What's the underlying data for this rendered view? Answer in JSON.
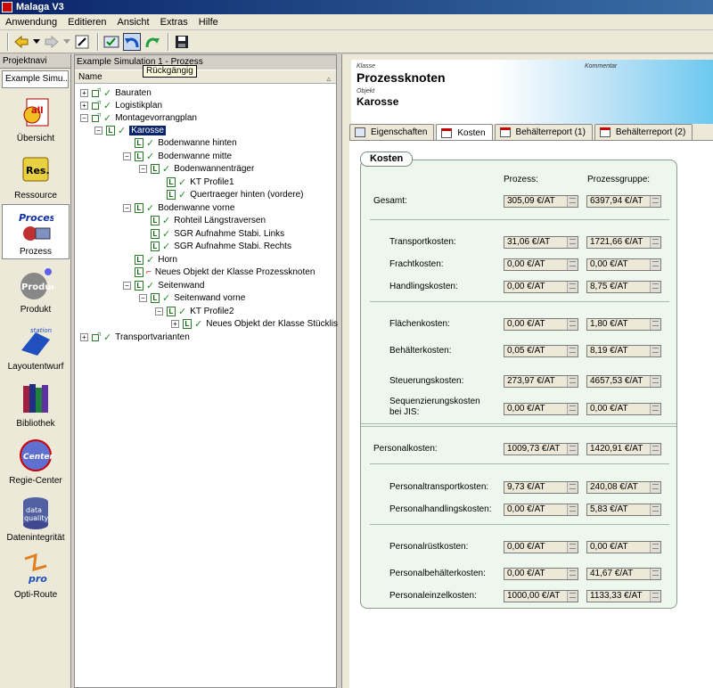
{
  "app": {
    "title": "Malaga V3"
  },
  "menu": [
    "Anwendung",
    "Editieren",
    "Ansicht",
    "Extras",
    "Hilfe"
  ],
  "tooltip": "Rückgängig",
  "left": {
    "header": "Projektnavi",
    "tab": "Example Simu...",
    "items": [
      {
        "label": "Übersicht",
        "icon": "overview-icon"
      },
      {
        "label": "Ressource",
        "icon": "resource-icon"
      },
      {
        "label": "Prozess",
        "icon": "process-icon"
      },
      {
        "label": "Produkt",
        "icon": "product-icon"
      },
      {
        "label": "Layoutentwurf",
        "icon": "layout-icon"
      },
      {
        "label": "Bibliothek",
        "icon": "library-icon"
      },
      {
        "label": "Regie-Center",
        "icon": "regie-icon"
      },
      {
        "label": "Datenintegrität",
        "icon": "data-quality-icon"
      },
      {
        "label": "Opti-Route",
        "icon": "opti-route-icon"
      }
    ]
  },
  "tree": {
    "title": "Example Simulation 1 - Prozess",
    "column": "Name",
    "rows": [
      {
        "label": "Bauraten",
        "exp": "+",
        "ico": "plus",
        "check": true
      },
      {
        "label": "Logistikplan",
        "exp": "+",
        "ico": "plus",
        "check": true
      },
      {
        "label": "Montagevorrangplan",
        "exp": "−",
        "ico": "plus",
        "check": true
      },
      {
        "label": "Karosse",
        "exp": "−",
        "ico": "box",
        "check": true,
        "selected": true
      },
      {
        "label": "Bodenwanne hinten",
        "exp": "",
        "ico": "box",
        "check": true
      },
      {
        "label": "Bodenwanne mitte",
        "exp": "−",
        "ico": "box",
        "check": true
      },
      {
        "label": "Bodenwannenträger",
        "exp": "−",
        "ico": "box",
        "check": true
      },
      {
        "label": "KT Profile1",
        "exp": "",
        "ico": "box",
        "check": true
      },
      {
        "label": "Quertraeger hinten (vordere)",
        "exp": "",
        "ico": "box",
        "check": true
      },
      {
        "label": "Bodenwanne vorne",
        "exp": "−",
        "ico": "box",
        "check": true
      },
      {
        "label": "Rohteil Längstraversen",
        "exp": "",
        "ico": "box",
        "check": true
      },
      {
        "label": "SGR Aufnahme Stabi. Links",
        "exp": "",
        "ico": "box",
        "check": true
      },
      {
        "label": "SGR Aufnahme Stabi. Rechts",
        "exp": "",
        "ico": "box",
        "check": true
      },
      {
        "label": "Horn",
        "exp": "",
        "ico": "box",
        "check": true
      },
      {
        "label": "Neues Objekt der Klasse Prozessknoten",
        "exp": "",
        "ico": "box",
        "check": false
      },
      {
        "label": "Seitenwand",
        "exp": "−",
        "ico": "box",
        "check": true
      },
      {
        "label": "Seitenwand vorne",
        "exp": "−",
        "ico": "box",
        "check": true
      },
      {
        "label": "KT Profile2",
        "exp": "−",
        "ico": "box",
        "check": true
      },
      {
        "label": "Neues Objekt der Klasse Stücklist...",
        "exp": "+",
        "ico": "box",
        "check": true
      },
      {
        "label": "Transportvarianten",
        "exp": "+",
        "ico": "plus",
        "check": true
      }
    ]
  },
  "detail": {
    "klasse_label": "Klasse",
    "klasse": "Prozessknoten",
    "kommentar_label": "Kommentar",
    "objekt_label": "Objekt",
    "objekt": "Karosse",
    "tabs": [
      "Eigenschaften",
      "Kosten",
      "Behälterreport (1)",
      "Behälterreport (2)"
    ],
    "kosten": {
      "title": "Kosten",
      "col_prozess": "Prozess:",
      "col_gruppe": "Prozessgruppe:",
      "rows": [
        {
          "label": "Gesamt:",
          "p": "305,09 €/AT",
          "g": "6397,94 €/AT"
        },
        {
          "label": "Transportkosten:",
          "p": "31,06 €/AT",
          "g": "1721,66 €/AT"
        },
        {
          "label": "Frachtkosten:",
          "p": "0,00 €/AT",
          "g": "0,00 €/AT"
        },
        {
          "label": "Handlingskosten:",
          "p": "0,00 €/AT",
          "g": "8,75 €/AT"
        },
        {
          "label": "Flächenkosten:",
          "p": "0,00 €/AT",
          "g": "1,80 €/AT"
        },
        {
          "label": "Behälterkosten:",
          "p": "0,05 €/AT",
          "g": "8,19 €/AT"
        },
        {
          "label": "Steuerungskosten:",
          "p": "273,97 €/AT",
          "g": "4657,53 €/AT"
        },
        {
          "label": "Sequenzierungskosten",
          "label2": "bei JIS:",
          "p": "0,00 €/AT",
          "g": "0,00 €/AT"
        },
        {
          "label": "Personalkosten:",
          "p": "1009,73 €/AT",
          "g": "1420,91 €/AT"
        },
        {
          "label": "Personaltransportkosten:",
          "p": "9,73 €/AT",
          "g": "240,08 €/AT"
        },
        {
          "label": "Personalhandlingskosten:",
          "p": "0,00 €/AT",
          "g": "5,83 €/AT"
        },
        {
          "label": "Personalrüstkosten:",
          "p": "0,00 €/AT",
          "g": "0,00 €/AT"
        },
        {
          "label": "Personalbehälterkosten:",
          "p": "0,00 €/AT",
          "g": "41,67 €/AT"
        },
        {
          "label": "Personaleinzelkosten:",
          "p": "1000,00 €/AT",
          "g": "1133,33 €/AT"
        }
      ]
    }
  }
}
